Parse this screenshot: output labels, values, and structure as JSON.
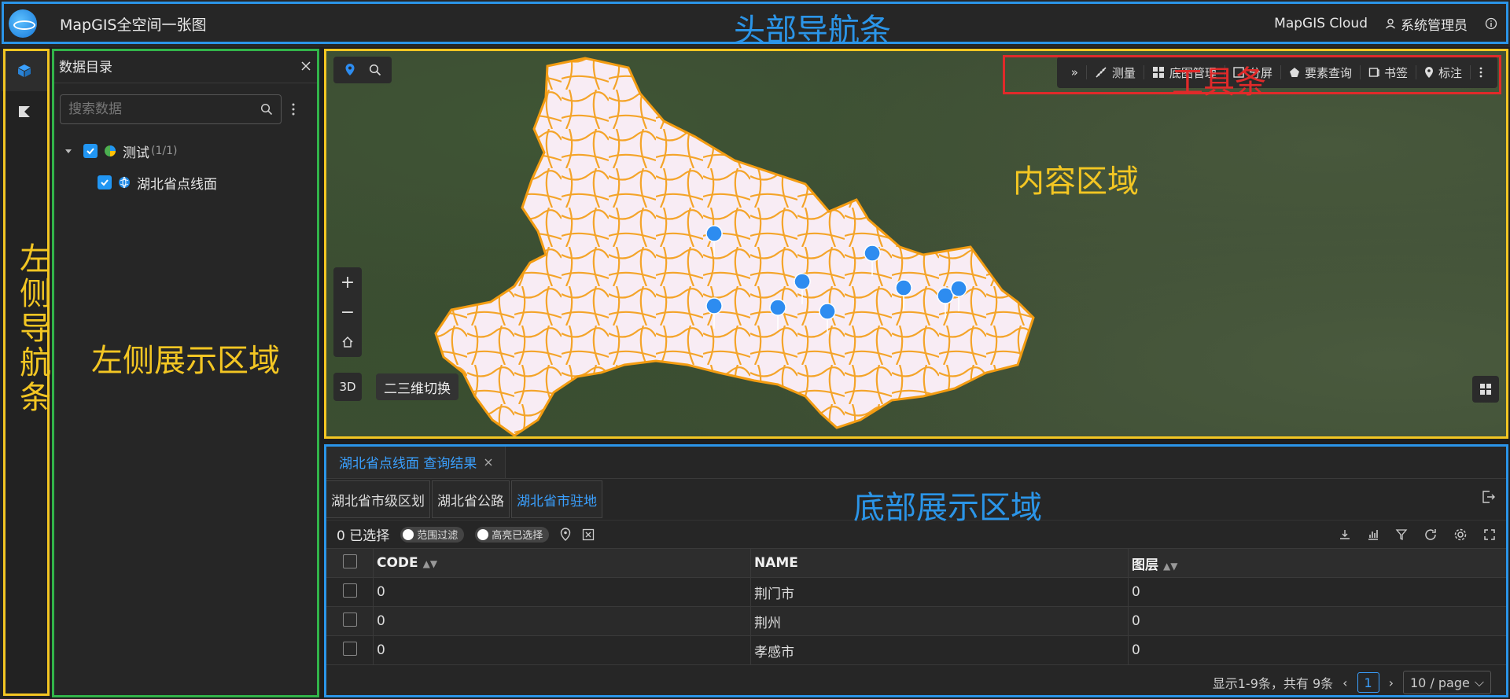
{
  "header": {
    "app_title": "MapGIS全空间一张图",
    "cloud_label": "MapGIS Cloud",
    "user_label": "系统管理员"
  },
  "left_nav": {
    "items": [
      "layers-icon",
      "paint-icon"
    ]
  },
  "left_panel": {
    "title": "数据目录",
    "search_placeholder": "搜索数据",
    "tree": {
      "group_label": "测试",
      "group_count": "(1/1)",
      "child_label": "湖北省点线面"
    }
  },
  "map": {
    "btn_3d": "3D",
    "tip_3d": "二三维切换",
    "toolbar": [
      {
        "label": "测量",
        "icon": "ruler-icon"
      },
      {
        "label": "底图管理",
        "icon": "grid-icon"
      },
      {
        "label": "分屏",
        "icon": "split-icon"
      },
      {
        "label": "要素查询",
        "icon": "feature-query-icon"
      },
      {
        "label": "书签",
        "icon": "bookmark-icon"
      },
      {
        "label": "标注",
        "icon": "marker-icon"
      }
    ]
  },
  "bottom": {
    "tab_label": "湖北省点线面 查询结果",
    "subtabs": [
      "湖北省市级区划",
      "湖北省公路",
      "湖北省市驻地"
    ],
    "active_subtab": 2,
    "selected_text": "0 已选择",
    "toggle_range": "范围过滤",
    "toggle_highlight": "高亮已选择",
    "columns": [
      "CODE",
      "NAME",
      "图层"
    ],
    "rows": [
      [
        "0",
        "荆门市",
        "0"
      ],
      [
        "0",
        "荆州",
        "0"
      ],
      [
        "0",
        "孝感市",
        "0"
      ]
    ],
    "pager_summary": "显示1-9条，共有 9条",
    "current_page": "1",
    "page_size": "10 / page"
  },
  "annotations": {
    "header": "头部导航条",
    "toolbar": "工具条",
    "content": "内容区域",
    "left_nav": "左侧导航条",
    "left_display": "左侧展示区域",
    "bottom_display": "底部展示区域"
  },
  "colors": {
    "accent": "#2196f3",
    "road": "#f39c12"
  }
}
